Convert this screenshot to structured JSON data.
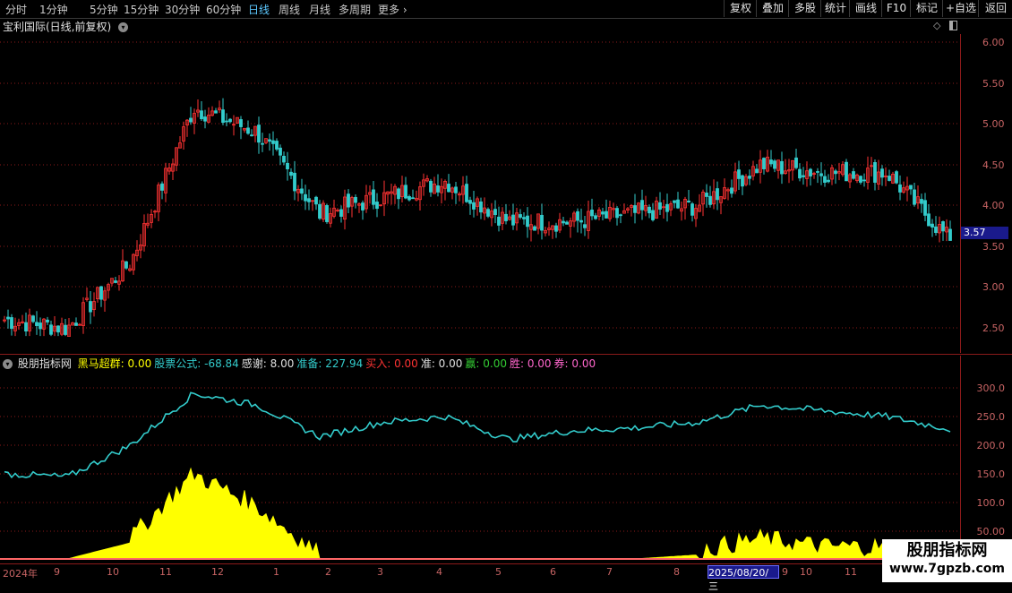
{
  "toolbar": {
    "periods": [
      "分时",
      "1分钟",
      "5分钟",
      "15分钟",
      "30分钟",
      "60分钟",
      "日线",
      "周线",
      "月线",
      "多周期",
      "更多"
    ],
    "active_period": "日线",
    "more_chevron": "chevron-right-icon",
    "right_buttons": [
      "复权",
      "叠加",
      "多股",
      "统计",
      "画线",
      "F10",
      "标记",
      "+自选",
      "返回"
    ]
  },
  "chart_title": {
    "name": "宝利国际(日线,前复权)",
    "dropdown_icon": "chevron-down-icon",
    "diamond_icon": "diamond-icon",
    "panel_icon": "panel-toggle-icon"
  },
  "price_axis": {
    "labels": [
      "6.00",
      "5.50",
      "5.00",
      "4.50",
      "4.00",
      "3.50",
      "3.00",
      "2.50"
    ],
    "current_price": "3.57"
  },
  "indicator": {
    "name": "股朋指标网",
    "items": [
      {
        "label": "黑马超群:",
        "value": "0.00",
        "color": "#ffff00"
      },
      {
        "label": "股票公式:",
        "value": "-68.84",
        "color": "#33cccc"
      },
      {
        "label": "感谢:",
        "value": "8.00",
        "color": "#e0e0e0"
      },
      {
        "label": "准备:",
        "value": "227.94",
        "color": "#33cccc"
      },
      {
        "label": "买入:",
        "value": "0.00",
        "color": "#ff3333"
      },
      {
        "label": "准:",
        "value": "0.00",
        "color": "#e0e0e0"
      },
      {
        "label": "赢:",
        "value": "0.00",
        "color": "#33cc33"
      },
      {
        "label": "胜:",
        "value": "0.00",
        "color": "#ff66cc"
      },
      {
        "label": "券:",
        "value": "0.00",
        "color": "#ff66cc"
      }
    ],
    "axis_labels": [
      "300.0",
      "250.0",
      "200.0",
      "150.0",
      "100.0",
      "50.00"
    ]
  },
  "time_axis": {
    "labels": [
      "2024年",
      "9",
      "10",
      "11",
      "12",
      "1",
      "2",
      "3",
      "4",
      "5",
      "6",
      "7",
      "8",
      "9",
      "10",
      "11"
    ],
    "cursor_date": "2025/08/20/三"
  },
  "watermark": {
    "line1": "股朋指标网",
    "line2": "www.7gpzb.com"
  },
  "colors": {
    "up": "#ff3333",
    "down": "#33cccc",
    "grid": "#8b1a1a",
    "indicator_line": "#33cccc",
    "indicator_fill": "#ffff00"
  },
  "chart_data": [
    {
      "type": "candlestick",
      "title": "宝利国际(日线,前复权)",
      "ylim": [
        2.3,
        6.1
      ],
      "x": [
        "2024-08",
        "2024-09",
        "2024-10",
        "2024-11",
        "2024-12",
        "2025-01",
        "2025-02",
        "2025-03",
        "2025-04",
        "2025-05",
        "2025-06",
        "2025-07",
        "2025-08",
        "2025-09",
        "2025-10",
        "2025-11"
      ],
      "close_approx": [
        2.6,
        2.5,
        3.3,
        5.2,
        4.9,
        3.9,
        4.1,
        4.3,
        3.8,
        3.8,
        3.9,
        4.0,
        4.5,
        4.4,
        4.4,
        3.57
      ],
      "high": 6.05,
      "low": 2.4,
      "last": 3.57
    },
    {
      "type": "line",
      "ylim": [
        50,
        330
      ],
      "series": [
        {
          "name": "准备",
          "values": [
            150,
            145,
            200,
            290,
            270,
            215,
            240,
            250,
            210,
            225,
            230,
            240,
            270,
            260,
            250,
            227.94
          ]
        }
      ]
    },
    {
      "type": "area",
      "series": [
        {
          "name": "黑马超群",
          "values": [
            0,
            0,
            20,
            100,
            60,
            0,
            0,
            0,
            0,
            0,
            0,
            5,
            20,
            10,
            10,
            0
          ]
        }
      ]
    }
  ]
}
